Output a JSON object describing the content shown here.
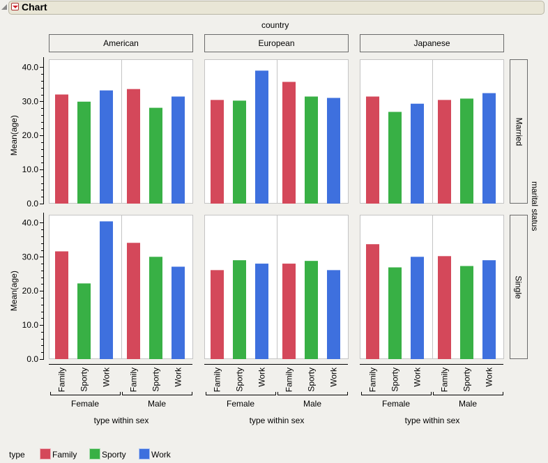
{
  "window": {
    "title": "Chart"
  },
  "chart_data": {
    "type": "bar",
    "title": "Chart",
    "column_group_label": "country",
    "columns": [
      "American",
      "European",
      "Japanese"
    ],
    "row_group_label": "marital status",
    "rows": [
      "Married",
      "Single"
    ],
    "xlabel": "type within sex",
    "ylabel": "Mean(age)",
    "sex_groups": [
      "Female",
      "Male"
    ],
    "categories": [
      "Family",
      "Sporty",
      "Work"
    ],
    "ylim": [
      0,
      40
    ],
    "yticks": [
      "0.0",
      "10.0",
      "20.0",
      "30.0",
      "40.0"
    ],
    "legend": {
      "title": "type",
      "position": "bottom-left",
      "entries": [
        {
          "name": "Family",
          "color": "#d4485a"
        },
        {
          "name": "Sporty",
          "color": "#38b045"
        },
        {
          "name": "Work",
          "color": "#3e70de"
        }
      ]
    },
    "panels": {
      "Married": {
        "American": {
          "Female": [
            32.0,
            29.9,
            33.2
          ],
          "Male": [
            33.6,
            28.1,
            31.4
          ]
        },
        "European": {
          "Female": [
            30.4,
            30.2,
            39.0
          ],
          "Male": [
            35.7,
            31.4,
            31.0
          ]
        },
        "Japanese": {
          "Female": [
            31.4,
            26.9,
            29.3
          ],
          "Male": [
            30.4,
            30.8,
            32.4
          ]
        }
      },
      "Single": {
        "American": {
          "Female": [
            31.6,
            22.2,
            40.4
          ],
          "Male": [
            34.1,
            30.0,
            27.1
          ]
        },
        "European": {
          "Female": [
            26.1,
            29.0,
            28.0
          ],
          "Male": [
            28.0,
            28.8,
            26.1
          ]
        },
        "Japanese": {
          "Female": [
            33.7,
            26.9,
            30.0
          ],
          "Male": [
            30.2,
            27.3,
            29.0
          ]
        }
      }
    }
  }
}
